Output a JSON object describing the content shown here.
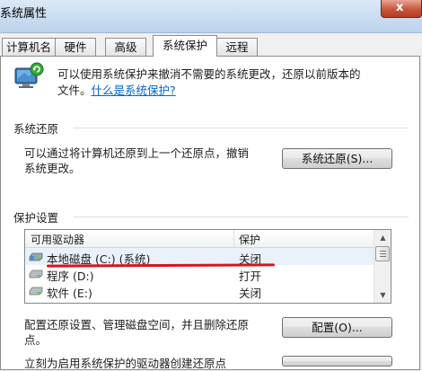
{
  "window": {
    "title": "系统属性",
    "close_glyph": "x"
  },
  "tabs": [
    {
      "label": "计算机名",
      "active": false
    },
    {
      "label": "硬件",
      "active": false
    },
    {
      "label": "高级",
      "active": false
    },
    {
      "label": "系统保护",
      "active": true
    },
    {
      "label": "远程",
      "active": false
    }
  ],
  "intro": {
    "line1": "可以使用系统保护来撤消不需要的系统更改，还原以前版本的",
    "line2_prefix": "文件。",
    "link": "什么是系统保护?"
  },
  "system_restore": {
    "heading": "系统还原",
    "desc_line1": "可以通过将计算机还原到上一个还原点，撤销",
    "desc_line2": "系统更改。",
    "button": "系统还原(S)..."
  },
  "protection": {
    "heading": "保护设置",
    "columns": [
      "可用驱动器",
      "保护"
    ],
    "rows": [
      {
        "drive": "本地磁盘 (C:) (系统)",
        "protection": "关闭"
      },
      {
        "drive": "程序 (D:)",
        "protection": "打开"
      },
      {
        "drive": "软件 (E:)",
        "protection": "关闭"
      }
    ]
  },
  "configure": {
    "desc_line1": "配置还原设置、管理磁盘空间，并且删除还原",
    "desc_line2": "点。",
    "button": "配置(O)..."
  },
  "create": {
    "desc_partial": "立刻为启用系统保护的驱动器创建还原点"
  },
  "colors": {
    "link": "#0066cc",
    "annotation_line": "#d9141e",
    "selection": "#e9f2fb"
  }
}
